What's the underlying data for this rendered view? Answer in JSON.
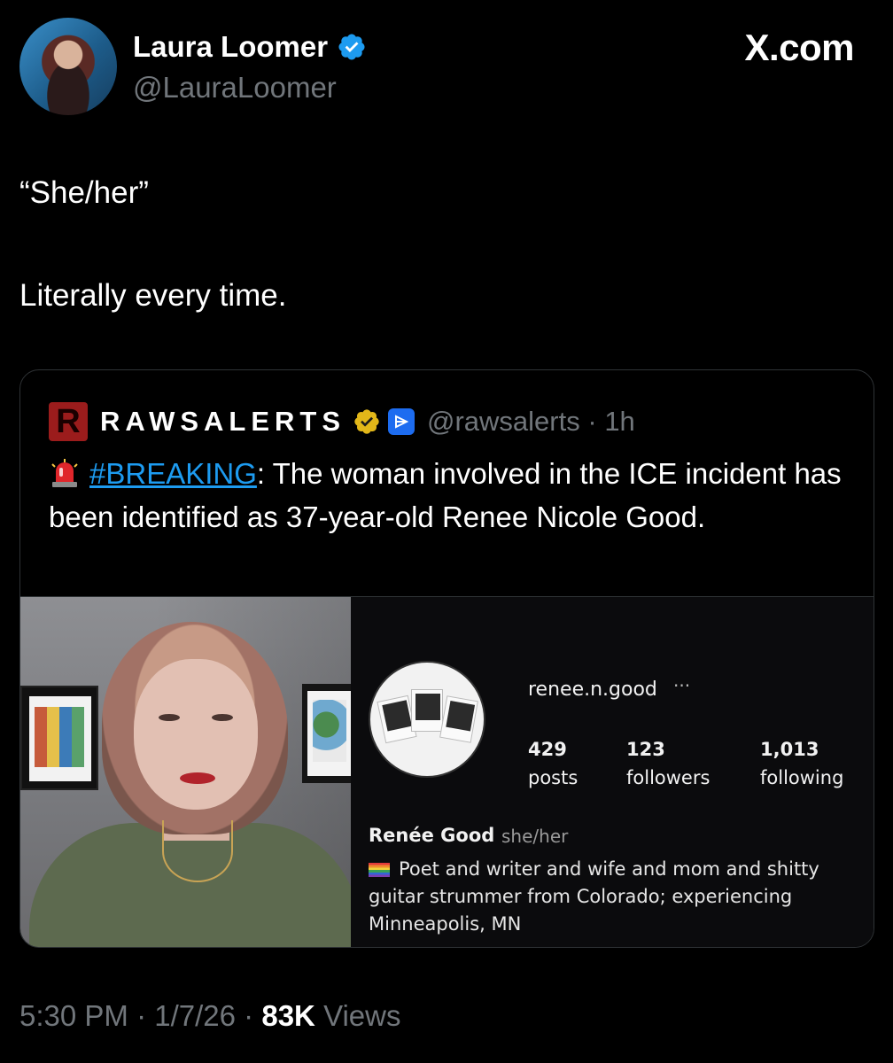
{
  "author": {
    "name": "Laura Loomer",
    "handle": "@LauraLoomer",
    "avatar_icon": "profile-photo",
    "verified_icon": "blue-verified-badge-icon"
  },
  "site_label": "X.com",
  "tweet": {
    "line1": "“She/her”",
    "line2": "Literally every time."
  },
  "quoted": {
    "logo_letter": "R",
    "name": "RAWSALERTS",
    "gold_badge_icon": "gold-verified-badge-icon",
    "affiliate_badge_icon": "affiliate-badge-icon",
    "handle": "@rawsalerts",
    "separator": "·",
    "time": "1h",
    "siren_icon": "siren-emoji",
    "hashtag": "#BREAKING",
    "text": ": The woman involved in the ICE incident has been identified as 37-year-old Renee Nicole Good."
  },
  "screenshot_profile": {
    "username": "renee.n.good",
    "more": "···",
    "stats": [
      {
        "value": "429",
        "label": "posts"
      },
      {
        "value": "123",
        "label": "followers"
      },
      {
        "value": "1,013",
        "label": "following"
      }
    ],
    "display_name": "Renée Good",
    "pronouns": "she/her",
    "bio": "Poet and writer and wife and mom and shitty guitar strummer from Colorado; experiencing Minneapolis, MN"
  },
  "footer": {
    "time": "5:30 PM",
    "sep1": "·",
    "date": "1/7/26",
    "sep2": "·",
    "views_count": "83K",
    "views_label": "Views"
  },
  "colors": {
    "background": "#000000",
    "link": "#1d9bf0",
    "muted": "#71767b",
    "verified_blue": "#1d9bf0",
    "verified_gold": "#e2b719"
  }
}
